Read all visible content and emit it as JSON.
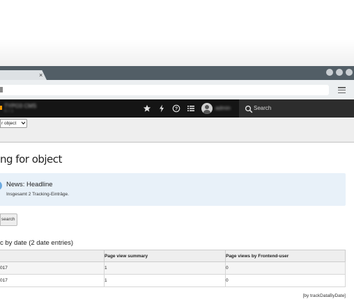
{
  "browser": {
    "tab_close": "×",
    "window_buttons": [
      "minimize",
      "maximize",
      "close"
    ]
  },
  "topbar": {
    "site_name": "TYPO3 CMS",
    "site_version": "8.7.1",
    "username": "admin",
    "search_label": "Search",
    "icons": [
      "star-icon",
      "bolt-icon",
      "help-icon",
      "list-icon",
      "user-avatar"
    ]
  },
  "docheader": {
    "selector_value": "r object"
  },
  "page": {
    "title": "ng for object",
    "info_title": "News: Headline",
    "info_text": "Insgesamt 2 Tracking-Einträge.",
    "button_label": "search",
    "section_title": "c by date (2 date entries)"
  },
  "table": {
    "headers": [
      "",
      "Page view summary",
      "Page views by Frontend-user"
    ],
    "rows": [
      [
        "017",
        "1",
        "0"
      ],
      [
        "017",
        "1",
        "0"
      ]
    ]
  },
  "footer_text": "[by trackDataByDate]"
}
